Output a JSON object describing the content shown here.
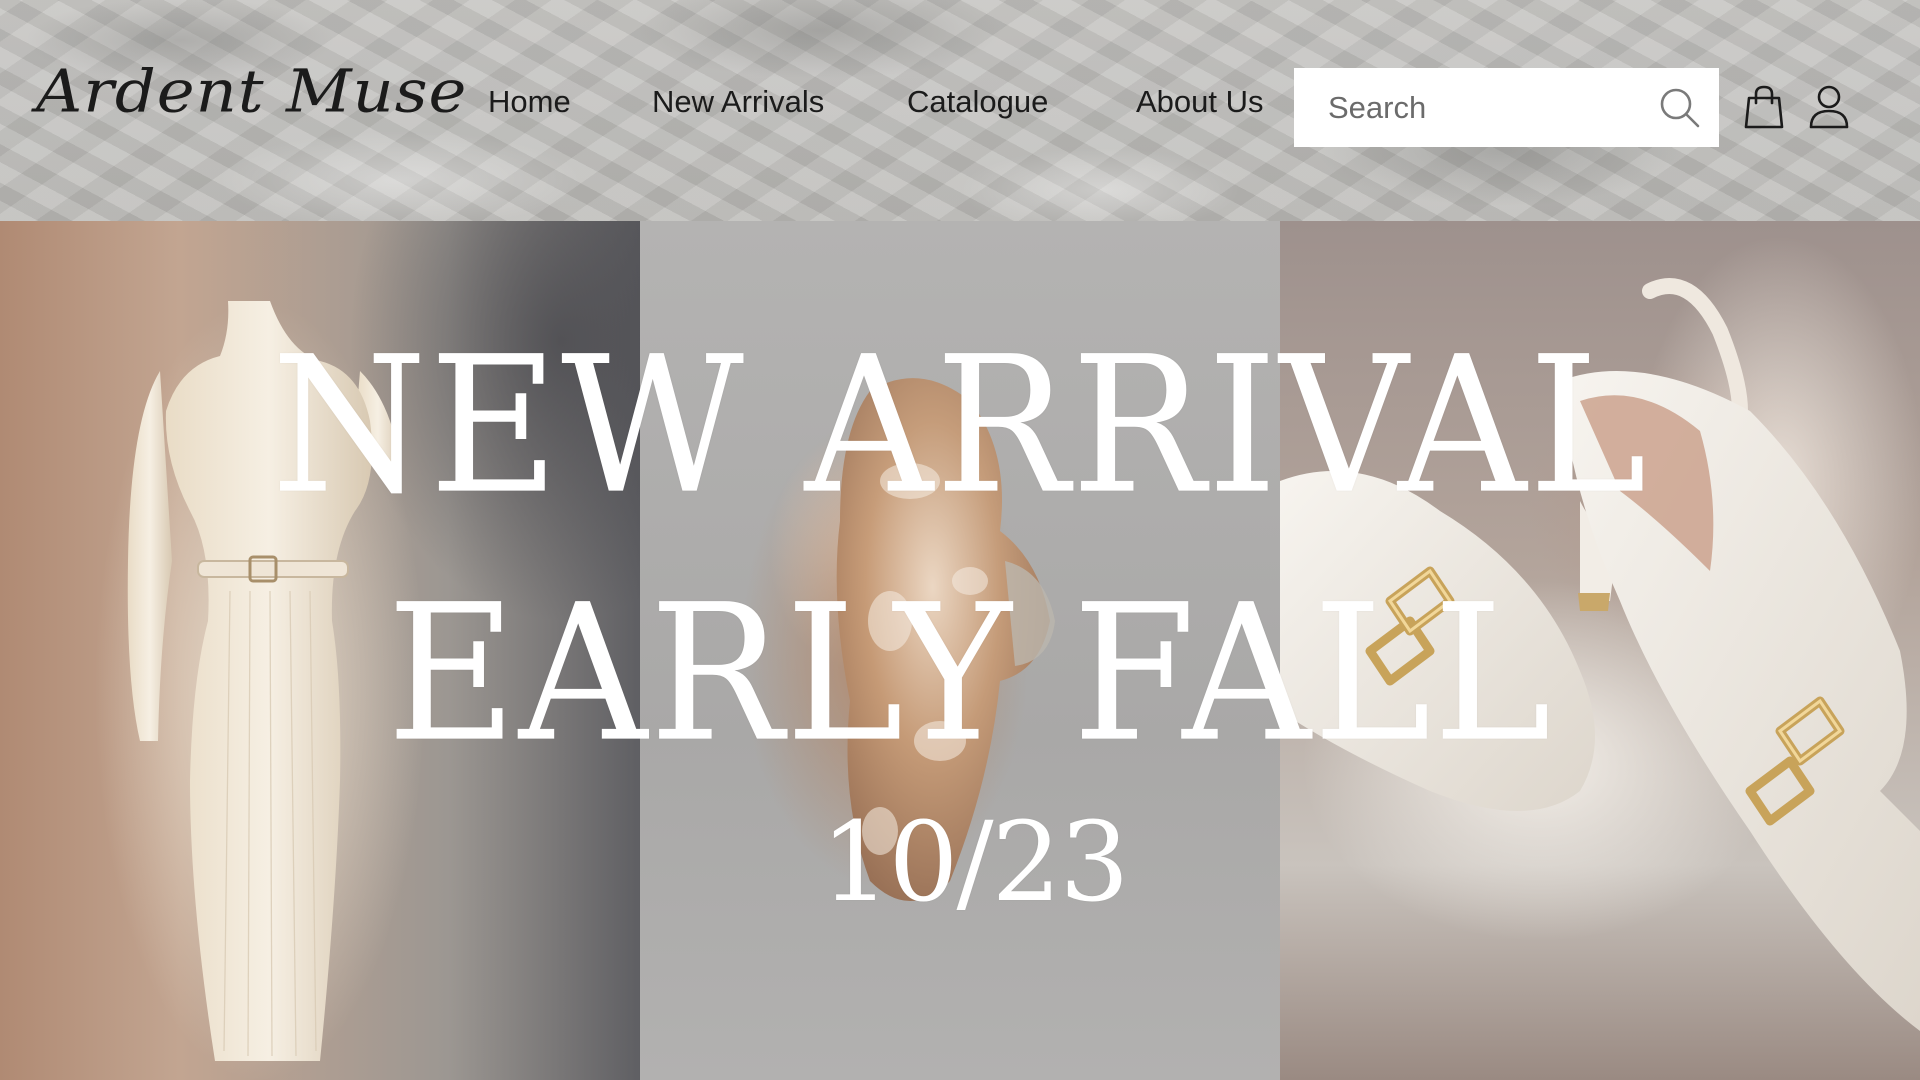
{
  "brand": {
    "logo_text": "Ardent Muse"
  },
  "nav": {
    "items": [
      {
        "label": "Home"
      },
      {
        "label": "New Arrivals"
      },
      {
        "label": "Catalogue"
      },
      {
        "label": "About Us"
      }
    ]
  },
  "search": {
    "placeholder": "Search",
    "value": ""
  },
  "icons": {
    "search": "search-icon",
    "bag": "shopping-bag-icon",
    "account": "user-icon"
  },
  "hero": {
    "line1": "NEW ARRIVAL",
    "line2": "EARLY FALL",
    "date": "10/23"
  },
  "colors": {
    "text_dark": "#1b1b1b",
    "hero_text": "#ffffff",
    "search_bg": "#ffffff"
  }
}
